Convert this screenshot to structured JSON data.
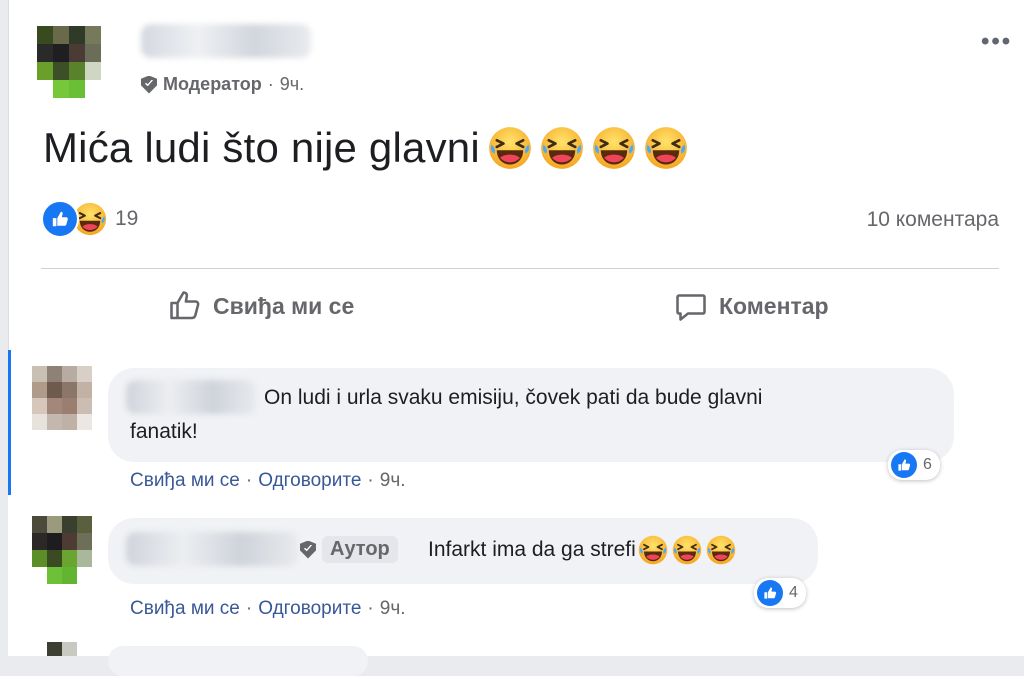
{
  "post": {
    "role": "Модератор",
    "time": "9ч.",
    "meta_dot": "·",
    "text": "Mića ludi što nije glavni",
    "reaction_count": "19",
    "comment_count": "10 коментара",
    "more_label": "•••",
    "like_label": "Свиђа ми се",
    "comment_label": "Коментар"
  },
  "comments": [
    {
      "text_line1": "On ludi i urla svaku emisiju, čovek pati da bude glavni",
      "text_line2": "fanatik!",
      "like": "Свиђа ми се",
      "reply": "Одговорите",
      "time": "9ч.",
      "dot": "·",
      "reactions": "6"
    },
    {
      "author_tag": "Аутор",
      "text": "Infarkt ima da ga strefi",
      "like": "Свиђа ми се",
      "reply": "Одговорите",
      "time": "9ч.",
      "dot": "·",
      "reactions": "4"
    }
  ],
  "colors": {
    "accent": "#1877f2",
    "meta": "#65676b",
    "link": "#385898"
  }
}
